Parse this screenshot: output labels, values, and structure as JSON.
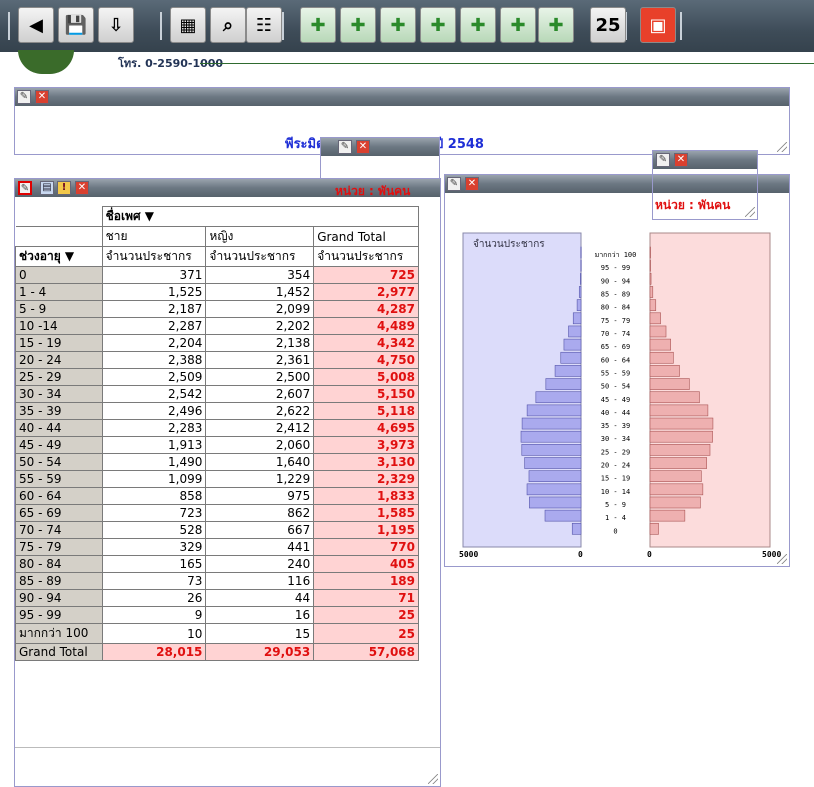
{
  "toolbar": {
    "buttons": [
      {
        "name": "back-icon",
        "glyph": "◀"
      },
      {
        "name": "save-icon",
        "glyph": "💾"
      },
      {
        "name": "export-icon",
        "glyph": "⇩"
      },
      {
        "name": "chart-picture-icon",
        "glyph": "▦"
      },
      {
        "name": "search-icon",
        "glyph": "⌕"
      },
      {
        "name": "tree-icon",
        "glyph": "☷"
      },
      {
        "name": "add-pivot-icon",
        "glyph": "✚"
      },
      {
        "name": "add-database-icon",
        "glyph": "✚"
      },
      {
        "name": "add-report-icon",
        "glyph": "✚"
      },
      {
        "name": "add-chart-icon",
        "glyph": "✚"
      },
      {
        "name": "add-sort-icon",
        "glyph": "✚"
      },
      {
        "name": "add-window-icon",
        "glyph": "✚"
      },
      {
        "name": "add-schedule-icon",
        "glyph": "✚"
      },
      {
        "name": "calendar-icon",
        "glyph": "25"
      },
      {
        "name": "exit-icon",
        "glyph": "▣"
      }
    ]
  },
  "header": {
    "phone": "โทร. 0-2590-1000"
  },
  "title_panel": {
    "title_left": "พีระมิด",
    "title_right": "ปี 2548"
  },
  "pivot": {
    "unit_label": "หน่วย : พันคน",
    "gender_field": "ชื่อเพศ ▼",
    "age_field": "ช่วงอายุ ▼",
    "col_headers": [
      "ชาย",
      "หญิง",
      "Grand Total"
    ],
    "measure": "จำนวนประชากร",
    "rows": [
      {
        "age": "0",
        "male": "371",
        "female": "354",
        "total": "725"
      },
      {
        "age": "1 - 4",
        "male": "1,525",
        "female": "1,452",
        "total": "2,977"
      },
      {
        "age": "5 - 9",
        "male": "2,187",
        "female": "2,099",
        "total": "4,287"
      },
      {
        "age": "10 -14",
        "male": "2,287",
        "female": "2,202",
        "total": "4,489"
      },
      {
        "age": "15 - 19",
        "male": "2,204",
        "female": "2,138",
        "total": "4,342"
      },
      {
        "age": "20 - 24",
        "male": "2,388",
        "female": "2,361",
        "total": "4,750"
      },
      {
        "age": "25 - 29",
        "male": "2,509",
        "female": "2,500",
        "total": "5,008"
      },
      {
        "age": "30 - 34",
        "male": "2,542",
        "female": "2,607",
        "total": "5,150"
      },
      {
        "age": "35 - 39",
        "male": "2,496",
        "female": "2,622",
        "total": "5,118"
      },
      {
        "age": "40 - 44",
        "male": "2,283",
        "female": "2,412",
        "total": "4,695"
      },
      {
        "age": "45 - 49",
        "male": "1,913",
        "female": "2,060",
        "total": "3,973"
      },
      {
        "age": "50 - 54",
        "male": "1,490",
        "female": "1,640",
        "total": "3,130"
      },
      {
        "age": "55 - 59",
        "male": "1,099",
        "female": "1,229",
        "total": "2,329"
      },
      {
        "age": "60 - 64",
        "male": "858",
        "female": "975",
        "total": "1,833"
      },
      {
        "age": "65 - 69",
        "male": "723",
        "female": "862",
        "total": "1,585"
      },
      {
        "age": "70 - 74",
        "male": "528",
        "female": "667",
        "total": "1,195"
      },
      {
        "age": "75 - 79",
        "male": "329",
        "female": "441",
        "total": "770"
      },
      {
        "age": "80 - 84",
        "male": "165",
        "female": "240",
        "total": "405"
      },
      {
        "age": "85 - 89",
        "male": "73",
        "female": "116",
        "total": "189"
      },
      {
        "age": "90 - 94",
        "male": "26",
        "female": "44",
        "total": "71"
      },
      {
        "age": "95 - 99",
        "male": "9",
        "female": "16",
        "total": "25"
      },
      {
        "age": "มากกว่า 100",
        "male": "10",
        "female": "15",
        "total": "25"
      }
    ],
    "grand_total": {
      "label": "Grand Total",
      "male": "28,015",
      "female": "29,053",
      "total": "57,068"
    }
  },
  "chart": {
    "unit_label": "หน่วย : พันคน",
    "left_label": "จำนวนประชากร",
    "age_labels": [
      "มากกว่า 100",
      "95 - 99",
      "90 - 94",
      "85 - 89",
      "80 - 84",
      "75 - 79",
      "70 - 74",
      "65 - 69",
      "60 - 64",
      "55 - 59",
      "50 - 54",
      "45 - 49",
      "40 - 44",
      "35 - 39",
      "30 - 34",
      "25 - 29",
      "20 - 24",
      "15 - 19",
      "10 - 14",
      "5 - 9",
      "1 - 4",
      "0"
    ],
    "axis_labels": {
      "left_max": "5000",
      "left_zero": "0",
      "right_zero": "0",
      "right_max": "5000"
    }
  },
  "chart_data": {
    "type": "bar",
    "orientation": "horizontal-pyramid",
    "categories": [
      "มากกว่า 100",
      "95 - 99",
      "90 - 94",
      "85 - 89",
      "80 - 84",
      "75 - 79",
      "70 - 74",
      "65 - 69",
      "60 - 64",
      "55 - 59",
      "50 - 54",
      "45 - 49",
      "40 - 44",
      "35 - 39",
      "30 - 34",
      "25 - 29",
      "20 - 24",
      "15 - 19",
      "10 - 14",
      "5 - 9",
      "1 - 4",
      "0"
    ],
    "series": [
      {
        "values": [
          10,
          9,
          26,
          73,
          165,
          329,
          528,
          723,
          858,
          1099,
          1490,
          1913,
          2283,
          2496,
          2542,
          2509,
          2388,
          2204,
          2287,
          2187,
          1525,
          371
        ],
        "color": "#aaaaee"
      },
      {
        "values": [
          15,
          16,
          44,
          116,
          240,
          441,
          667,
          862,
          975,
          1229,
          1640,
          2060,
          2412,
          2622,
          2607,
          2500,
          2361,
          2138,
          2202,
          2099,
          1452,
          354
        ],
        "color": "#eeb0b0"
      }
    ],
    "title": "",
    "xlim": [
      0,
      5000
    ],
    "grid": false
  }
}
